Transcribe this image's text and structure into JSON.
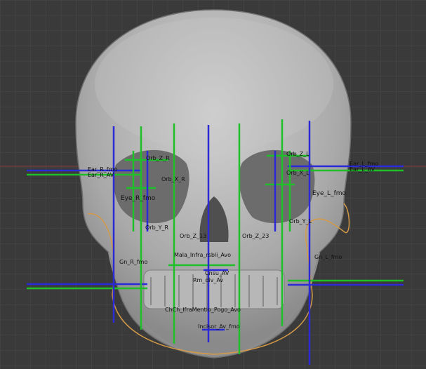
{
  "colors": {
    "background": "#3a3a3a",
    "grid": "#4a4a4a",
    "axis_x": "#8a3a3a",
    "bone": "#bdbdbd",
    "contour": "#d49a48",
    "green_guide": "#1fbf2a",
    "blue_guide": "#2a2ad6"
  },
  "landmarks": {
    "ear_r_fmo": "Ear_R_fmo",
    "ear_r_av": "Ear_R_AV",
    "ear_l_fmo": "Ear_L_fmo",
    "ear_l_av": "Ear_L_AV",
    "orb_z_r": "Orb_Z_R",
    "orb_x_r": "Orb_X_R",
    "orb_z_l": "Orb_Z_L",
    "orb_x_l": "Orb_X_L",
    "eye_r_fmo": "Eye_R_fmo",
    "eye_l_fmo": "Eye_L_fmo",
    "orb_y_r": "Orb_Y_R",
    "orb_y_l": "Orb_Y_L",
    "orb_z_13": "Orb_Z_13",
    "orb_z_23": "Orb_Z_23",
    "gn_r_fmo": "Gn_R_fmo",
    "gn_l_fmo": "Gn_L_fmo",
    "mala_infra": "Mala_Infra_rsbli_Avo",
    "chch": "ChCh_IfraMentlo_Pogo_Avo",
    "cnsul": "Cnsu_AV",
    "rmdiv": "Rm_div_Av",
    "bottom": "Incisor_Av_fmo"
  }
}
